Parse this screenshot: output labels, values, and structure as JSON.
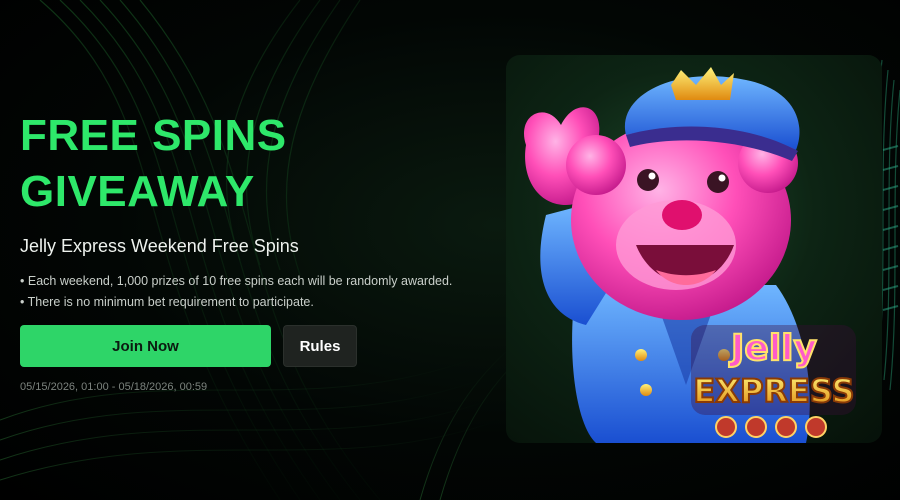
{
  "promo": {
    "headline_line1": "FREE SPINS",
    "headline_line2": "GIVEAWAY",
    "subtitle": "Jelly Express Weekend Free Spins",
    "bullets": [
      "Each weekend, 1,000 prizes of 10 free spins each will be randomly awarded.",
      "There is no minimum bet requirement to participate."
    ],
    "join_label": "Join Now",
    "rules_label": "Rules",
    "date_range": "05/15/2026, 01:00 - 05/18/2026, 00:59"
  },
  "game": {
    "logo_line1": "Jelly",
    "logo_line2": "EXPRESS"
  },
  "colors": {
    "accent": "#2ed568",
    "headline": "#2ee86a",
    "background": "#000000",
    "rules_button": "#1f2320"
  }
}
